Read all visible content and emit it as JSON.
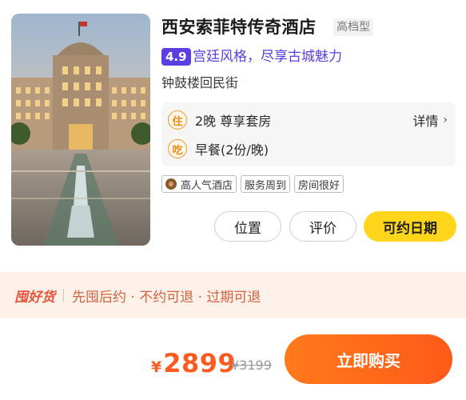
{
  "hotel": {
    "name": "西安索菲特传奇酒店",
    "grade": "高档型",
    "score": "4.9",
    "slogan": "宫廷风格，尽享古城魅力",
    "location": "钟鼓楼回民街"
  },
  "package": {
    "stay_icon": "住",
    "stay_text": "2晚 尊享套房",
    "detail_label": "详情",
    "meal_icon": "吃",
    "meal_text": "早餐(2份/晚)"
  },
  "tags": [
    "高人气酒店",
    "服务周到",
    "房间很好"
  ],
  "actions": {
    "location": "位置",
    "review": "评价",
    "date": "可约日期"
  },
  "promo": {
    "brand": "囤好货",
    "text": "先囤后约 · 不约可退 · 过期可退"
  },
  "purchase": {
    "currency": "¥",
    "price": "2899",
    "original_price": "¥3199",
    "buy_label": "立即购买"
  },
  "colors": {
    "accent_purple": "#5b3fe0",
    "accent_yellow": "#ffd61c",
    "price_orange": "#ff5a1f",
    "promo_bg": "#fdf1ea"
  },
  "icons": {
    "medal": "medal-icon",
    "chevron": "chevron-right-icon"
  }
}
